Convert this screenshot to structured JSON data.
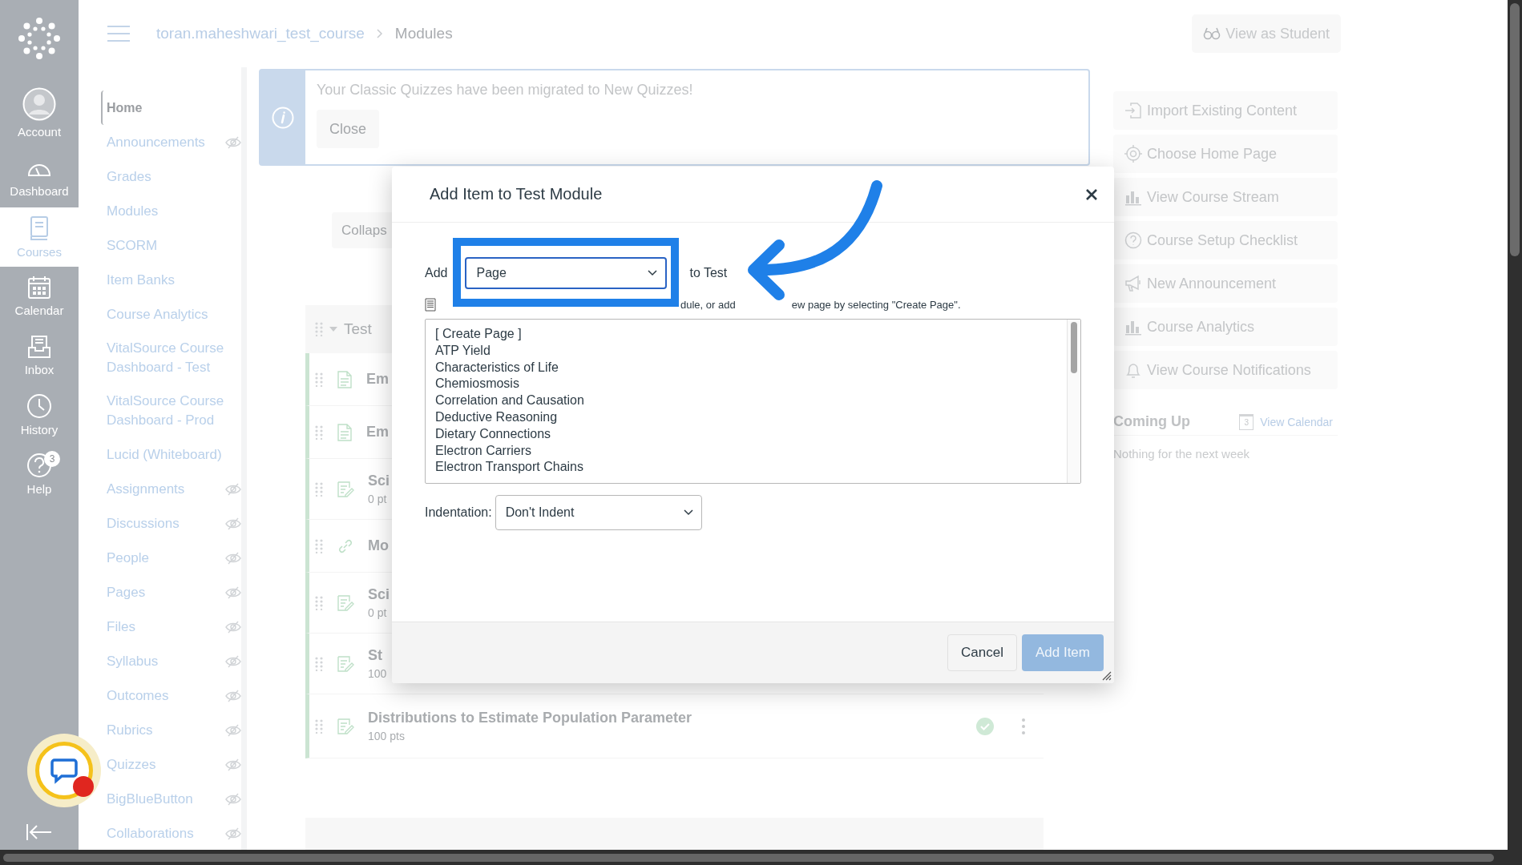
{
  "global_nav": {
    "items": [
      {
        "label": "Account",
        "kind": "account",
        "selected": false
      },
      {
        "label": "Dashboard",
        "kind": "dashboard",
        "selected": false
      },
      {
        "label": "Courses",
        "kind": "courses",
        "selected": true
      },
      {
        "label": "Calendar",
        "kind": "calendar",
        "selected": false
      },
      {
        "label": "Inbox",
        "kind": "inbox",
        "selected": false
      },
      {
        "label": "History",
        "kind": "history",
        "selected": false
      },
      {
        "label": "Help",
        "kind": "help",
        "selected": false,
        "badge": "3"
      }
    ]
  },
  "header": {
    "breadcrumb": [
      "toran.maheshwari_test_course",
      "Modules"
    ],
    "view_as_student": "View as Student"
  },
  "course_nav": [
    {
      "label": "Home",
      "selected": true,
      "hidden": false
    },
    {
      "label": "Announcements",
      "selected": false,
      "hidden": true
    },
    {
      "label": "Grades",
      "selected": false,
      "hidden": false
    },
    {
      "label": "Modules",
      "selected": false,
      "hidden": false
    },
    {
      "label": "SCORM",
      "selected": false,
      "hidden": false
    },
    {
      "label": "Item Banks",
      "selected": false,
      "hidden": false
    },
    {
      "label": "Course Analytics",
      "selected": false,
      "hidden": false
    },
    {
      "label": "VitalSource Course Dashboard - Test",
      "selected": false,
      "hidden": false
    },
    {
      "label": "VitalSource Course Dashboard - Prod",
      "selected": false,
      "hidden": false
    },
    {
      "label": "Lucid (Whiteboard)",
      "selected": false,
      "hidden": false
    },
    {
      "label": "Assignments",
      "selected": false,
      "hidden": true
    },
    {
      "label": "Discussions",
      "selected": false,
      "hidden": true
    },
    {
      "label": "People",
      "selected": false,
      "hidden": true
    },
    {
      "label": "Pages",
      "selected": false,
      "hidden": true
    },
    {
      "label": "Files",
      "selected": false,
      "hidden": true
    },
    {
      "label": "Syllabus",
      "selected": false,
      "hidden": true
    },
    {
      "label": "Outcomes",
      "selected": false,
      "hidden": true
    },
    {
      "label": "Rubrics",
      "selected": false,
      "hidden": true
    },
    {
      "label": "Quizzes",
      "selected": false,
      "hidden": true
    },
    {
      "label": "BigBlueButton",
      "selected": false,
      "hidden": true
    },
    {
      "label": "Collaborations",
      "selected": false,
      "hidden": true
    }
  ],
  "notice": {
    "message": "Your Classic Quizzes have been migrated to New Quizzes!",
    "close": "Close"
  },
  "collapse_button": "Collaps",
  "module": {
    "title": "Test",
    "items": [
      {
        "title": "Em",
        "kind": "page"
      },
      {
        "title": "Em",
        "kind": "page"
      },
      {
        "title": "Sci",
        "kind": "quiz",
        "points": "0 pt"
      },
      {
        "title": "Mo",
        "kind": "link"
      },
      {
        "title": "Sci",
        "kind": "quiz",
        "points": "0 pt"
      },
      {
        "title": "St",
        "kind": "quiz",
        "points": "100"
      },
      {
        "title": "Distributions to Estimate Population Parameter",
        "kind": "quiz",
        "points": "100 pts",
        "published": true
      }
    ]
  },
  "sidebar": {
    "buttons": [
      {
        "label": "Import Existing Content",
        "kind": "import"
      },
      {
        "label": "Choose Home Page",
        "kind": "target"
      },
      {
        "label": "View Course Stream",
        "kind": "chart"
      },
      {
        "label": "Course Setup Checklist",
        "kind": "help"
      },
      {
        "label": "New Announcement",
        "kind": "announce"
      },
      {
        "label": "Course Analytics",
        "kind": "chart"
      },
      {
        "label": "View Course Notifications",
        "kind": "bell"
      }
    ],
    "coming_up": {
      "title": "Coming Up",
      "calendar_day": "3",
      "link": "View Calendar",
      "empty": "Nothing for the next week"
    }
  },
  "dialog": {
    "title": "Add Item to Test Module",
    "add_label": "Add",
    "type_value": "Page",
    "to_label": "to Test",
    "hint_parts": [
      "dule, or add",
      "ew page by selecting \"Create Page\"."
    ],
    "options": [
      "[ Create Page ]",
      "ATP Yield",
      "Characteristics of Life",
      "Chemiosmosis",
      "Correlation and Causation",
      "Deductive Reasoning",
      "Dietary Connections",
      "Electron Carriers",
      "Electron Transport Chains"
    ],
    "indentation_label": "Indentation:",
    "indentation_value": "Don't Indent",
    "cancel": "Cancel",
    "add_button": {
      "label": "Add Item",
      "disabled": true
    }
  }
}
